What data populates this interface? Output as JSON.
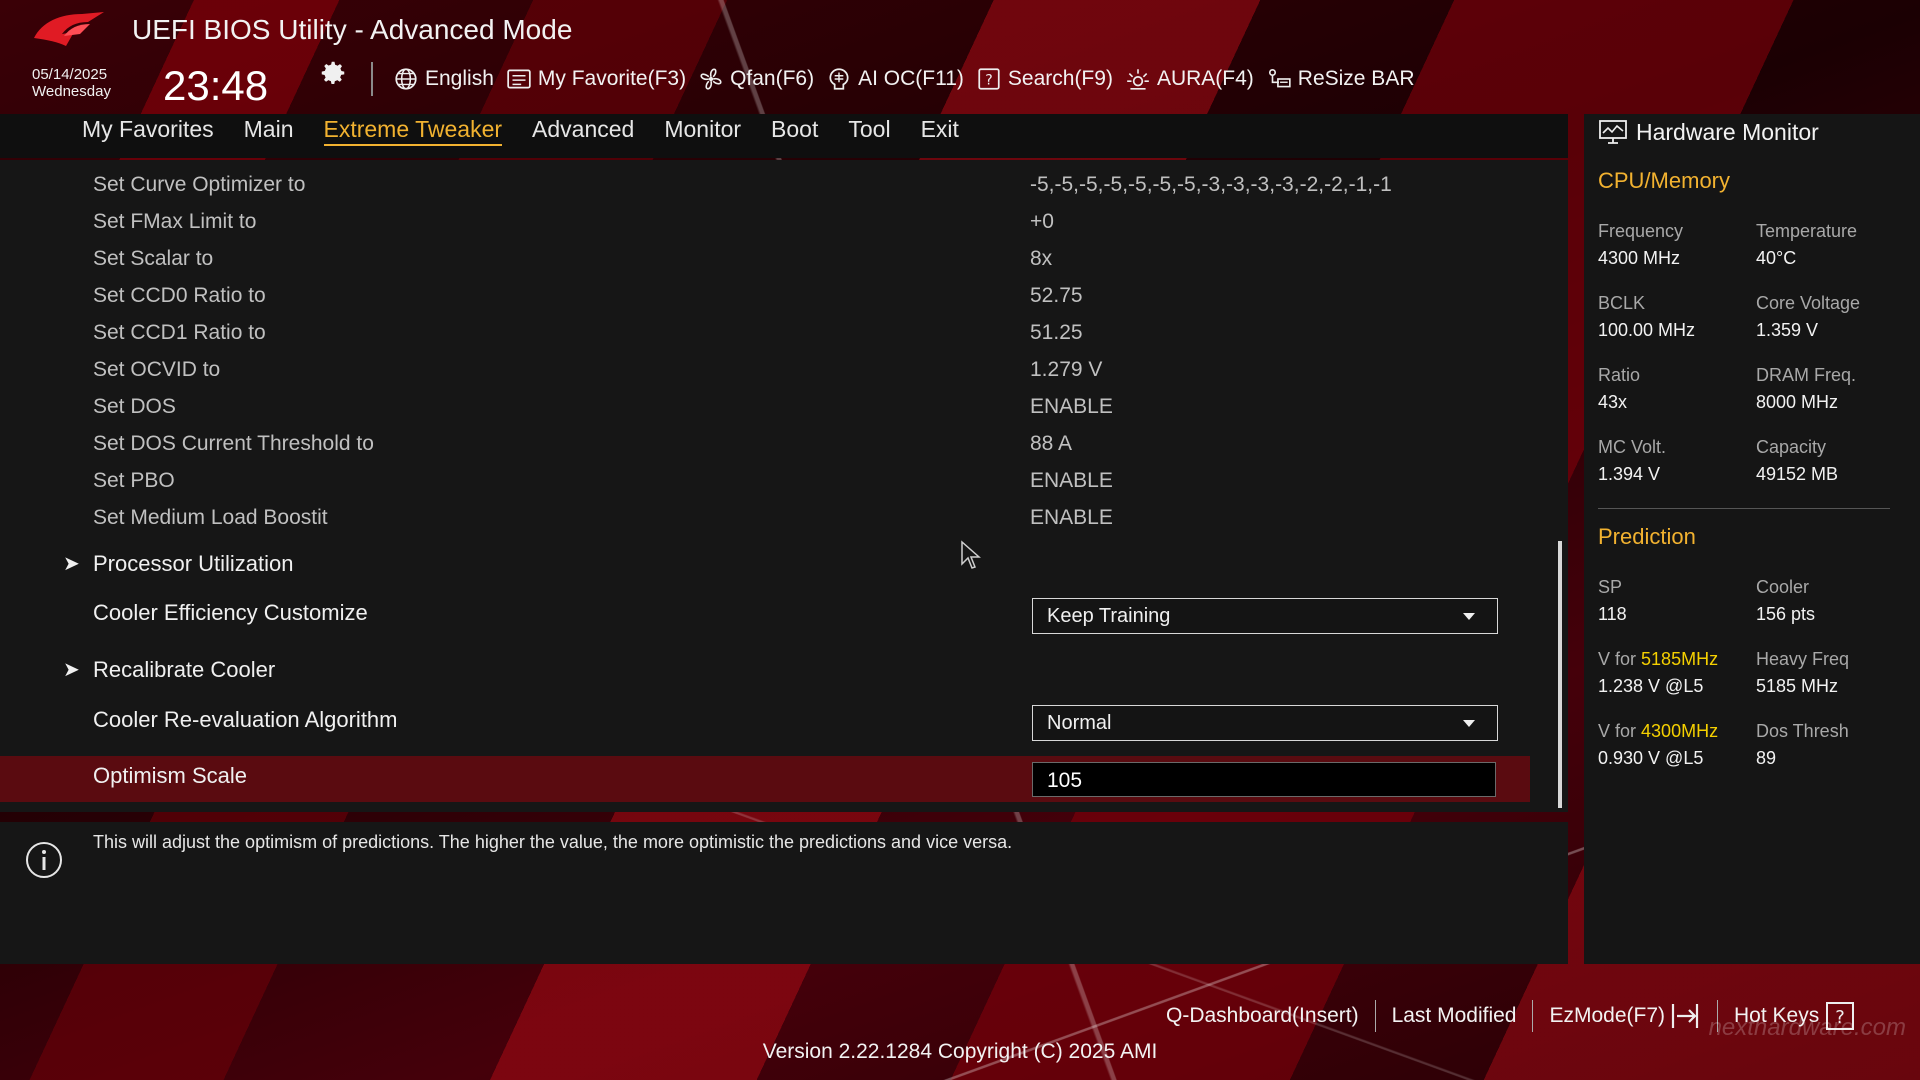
{
  "header": {
    "title": "UEFI BIOS Utility - Advanced Mode",
    "date": "05/14/2025",
    "weekday": "Wednesday",
    "time": "23:48",
    "toolbar": {
      "language": "English",
      "favorite": "My Favorite(F3)",
      "qfan": "Qfan(F6)",
      "aioc": "AI OC(F11)",
      "search": "Search(F9)",
      "aura": "AURA(F4)",
      "resize": "ReSize BAR"
    }
  },
  "menu": {
    "items": [
      "My Favorites",
      "Main",
      "Extreme Tweaker",
      "Advanced",
      "Monitor",
      "Boot",
      "Tool",
      "Exit"
    ],
    "active": "Extreme Tweaker"
  },
  "settings": [
    {
      "label": "Set Curve Optimizer to",
      "value": "-5,-5,-5,-5,-5,-5,-5,-3,-3,-3,-3,-2,-2,-1,-1"
    },
    {
      "label": "Set FMax Limit to",
      "value": "+0"
    },
    {
      "label": "Set Scalar to",
      "value": "8x"
    },
    {
      "label": "Set CCD0 Ratio to",
      "value": "52.75"
    },
    {
      "label": "Set CCD1 Ratio to",
      "value": "51.25"
    },
    {
      "label": "Set OCVID to",
      "value": "1.279 V"
    },
    {
      "label": "Set DOS",
      "value": "ENABLE"
    },
    {
      "label": "Set DOS Current Threshold to",
      "value": "88 A"
    },
    {
      "label": "Set PBO",
      "value": "ENABLE"
    },
    {
      "label": "Set Medium Load Boostit",
      "value": "ENABLE"
    }
  ],
  "options": {
    "processor_utilization": "Processor Utilization",
    "cooler_efficiency": {
      "label": "Cooler Efficiency Customize",
      "value": "Keep Training"
    },
    "recalibrate": "Recalibrate Cooler",
    "reeval": {
      "label": "Cooler Re-evaluation Algorithm",
      "value": "Normal"
    },
    "optimism": {
      "label": "Optimism Scale",
      "value": "105"
    }
  },
  "info": "This will adjust the optimism of predictions. The higher the value, the more optimistic the predictions and vice versa.",
  "hardware_monitor": {
    "title": "Hardware Monitor",
    "cpu_memory": {
      "title": "CPU/Memory",
      "frequency": {
        "k": "Frequency",
        "v": "4300 MHz"
      },
      "temperature": {
        "k": "Temperature",
        "v": "40°C"
      },
      "bclk": {
        "k": "BCLK",
        "v": "100.00 MHz"
      },
      "core_voltage": {
        "k": "Core Voltage",
        "v": "1.359 V"
      },
      "ratio": {
        "k": "Ratio",
        "v": "43x"
      },
      "dram_freq": {
        "k": "DRAM Freq.",
        "v": "8000 MHz"
      },
      "mc_volt": {
        "k": "MC Volt.",
        "v": "1.394 V"
      },
      "capacity": {
        "k": "Capacity",
        "v": "49152 MB"
      }
    },
    "prediction": {
      "title": "Prediction",
      "sp": {
        "k": "SP",
        "v": "118"
      },
      "cooler": {
        "k": "Cooler",
        "v": "156 pts"
      },
      "v1_prefix": "V for",
      "v1_freq": "5185MHz",
      "v1_value": "1.238 V @L5",
      "heavy": {
        "k": "Heavy Freq",
        "v": "5185 MHz"
      },
      "v2_prefix": "V for",
      "v2_freq": "4300MHz",
      "v2_value": "0.930 V @L5",
      "dos": {
        "k": "Dos Thresh",
        "v": "89"
      }
    }
  },
  "footer": {
    "qdashboard": "Q-Dashboard(Insert)",
    "last_modified": "Last Modified",
    "ezmode": "EzMode(F7)",
    "hotkeys": "Hot Keys",
    "version": "Version 2.22.1284 Copyright (C) 2025 AMI",
    "watermark": "nexthardware.com"
  },
  "colors": {
    "accent": "#f2b230",
    "selection": "#5a0b10",
    "highlight": "#f5d000"
  }
}
